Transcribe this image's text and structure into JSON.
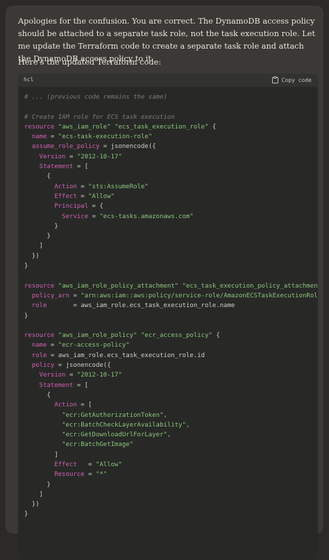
{
  "message": {
    "paragraph1": "Apologies for the confusion. You are correct. The DynamoDB access policy should be attached to a separate task role, not the task execution role. Let me update the Terraform code to create a separate task role and attach the DynamoDB access policy to it.",
    "paragraph2": "Here's the updated Terraform code:"
  },
  "code_block": {
    "language": "hcl",
    "copy_label": "Copy code",
    "copy_icon": "clipboard-icon",
    "lines": [
      [
        {
          "t": "# ... (previous code remains the same)",
          "c": "c"
        }
      ],
      [],
      [
        {
          "t": "# Create IAM role for ECS task execution",
          "c": "c"
        }
      ],
      [
        {
          "t": "resource ",
          "c": "k"
        },
        {
          "t": "\"aws_iam_role\"",
          "c": "s"
        },
        {
          "t": " ",
          "c": "p"
        },
        {
          "t": "\"ecs_task_execution_role\"",
          "c": "s"
        },
        {
          "t": " {",
          "c": "p"
        }
      ],
      [
        {
          "t": "  name",
          "c": "k"
        },
        {
          "t": " = ",
          "c": "p"
        },
        {
          "t": "\"ecs-task-execution-role\"",
          "c": "s"
        }
      ],
      [
        {
          "t": "  assume_role_policy",
          "c": "k"
        },
        {
          "t": " = jsonencode({",
          "c": "p"
        }
      ],
      [
        {
          "t": "    Version",
          "c": "k"
        },
        {
          "t": " = ",
          "c": "p"
        },
        {
          "t": "\"2012-10-17\"",
          "c": "s"
        }
      ],
      [
        {
          "t": "    Statement",
          "c": "k"
        },
        {
          "t": " = [",
          "c": "p"
        }
      ],
      [
        {
          "t": "      {",
          "c": "p"
        }
      ],
      [
        {
          "t": "        Action",
          "c": "k"
        },
        {
          "t": " = ",
          "c": "p"
        },
        {
          "t": "\"sts:AssumeRole\"",
          "c": "s"
        }
      ],
      [
        {
          "t": "        Effect",
          "c": "k"
        },
        {
          "t": " = ",
          "c": "p"
        },
        {
          "t": "\"Allow\"",
          "c": "s"
        }
      ],
      [
        {
          "t": "        Principal",
          "c": "k"
        },
        {
          "t": " = {",
          "c": "p"
        }
      ],
      [
        {
          "t": "          Service",
          "c": "k"
        },
        {
          "t": " = ",
          "c": "p"
        },
        {
          "t": "\"ecs-tasks.amazonaws.com\"",
          "c": "s"
        }
      ],
      [
        {
          "t": "        }",
          "c": "p"
        }
      ],
      [
        {
          "t": "      }",
          "c": "p"
        }
      ],
      [
        {
          "t": "    ]",
          "c": "p"
        }
      ],
      [
        {
          "t": "  })",
          "c": "p"
        }
      ],
      [
        {
          "t": "}",
          "c": "p"
        }
      ],
      [],
      [
        {
          "t": "resource ",
          "c": "k"
        },
        {
          "t": "\"aws_iam_role_policy_attachment\"",
          "c": "s"
        },
        {
          "t": " ",
          "c": "p"
        },
        {
          "t": "\"ecs_task_execution_policy_attachment\"",
          "c": "s"
        },
        {
          "t": " {",
          "c": "p"
        }
      ],
      [
        {
          "t": "  policy_arn",
          "c": "k"
        },
        {
          "t": " = ",
          "c": "p"
        },
        {
          "t": "\"arn:aws:iam::aws:policy/service-role/AmazonECSTaskExecutionRolePoli",
          "c": "s"
        }
      ],
      [
        {
          "t": "  role",
          "c": "k"
        },
        {
          "t": "       = aws_iam_role.ecs_task_execution_role.name",
          "c": "p"
        }
      ],
      [
        {
          "t": "}",
          "c": "p"
        }
      ],
      [],
      [
        {
          "t": "resource ",
          "c": "k"
        },
        {
          "t": "\"aws_iam_role_policy\"",
          "c": "s"
        },
        {
          "t": " ",
          "c": "p"
        },
        {
          "t": "\"ecr_access_policy\"",
          "c": "s"
        },
        {
          "t": " {",
          "c": "p"
        }
      ],
      [
        {
          "t": "  name",
          "c": "k"
        },
        {
          "t": " = ",
          "c": "p"
        },
        {
          "t": "\"ecr-access-policy\"",
          "c": "s"
        }
      ],
      [
        {
          "t": "  role",
          "c": "k"
        },
        {
          "t": " = aws_iam_role.ecs_task_execution_role.id",
          "c": "p"
        }
      ],
      [
        {
          "t": "  policy",
          "c": "k"
        },
        {
          "t": " = jsonencode({",
          "c": "p"
        }
      ],
      [
        {
          "t": "    Version",
          "c": "k"
        },
        {
          "t": " = ",
          "c": "p"
        },
        {
          "t": "\"2012-10-17\"",
          "c": "s"
        }
      ],
      [
        {
          "t": "    Statement",
          "c": "k"
        },
        {
          "t": " = [",
          "c": "p"
        }
      ],
      [
        {
          "t": "      {",
          "c": "p"
        }
      ],
      [
        {
          "t": "        Action",
          "c": "k"
        },
        {
          "t": " = [",
          "c": "p"
        }
      ],
      [
        {
          "t": "          \"ecr:GetAuthorizationToken\",",
          "c": "s"
        }
      ],
      [
        {
          "t": "          \"ecr:BatchCheckLayerAvailability\",",
          "c": "s"
        }
      ],
      [
        {
          "t": "          \"ecr:GetDownloadUrlForLayer\",",
          "c": "s"
        }
      ],
      [
        {
          "t": "          \"ecr:BatchGetImage\"",
          "c": "s"
        }
      ],
      [
        {
          "t": "        ]",
          "c": "p"
        }
      ],
      [
        {
          "t": "        Effect",
          "c": "k"
        },
        {
          "t": "   = ",
          "c": "p"
        },
        {
          "t": "\"Allow\"",
          "c": "s"
        }
      ],
      [
        {
          "t": "        Resource",
          "c": "k"
        },
        {
          "t": " = ",
          "c": "p"
        },
        {
          "t": "\"*\"",
          "c": "s"
        }
      ],
      [
        {
          "t": "      }",
          "c": "p"
        }
      ],
      [
        {
          "t": "    ]",
          "c": "p"
        }
      ],
      [
        {
          "t": "  })",
          "c": "p"
        }
      ],
      [
        {
          "t": "}",
          "c": "p"
        }
      ]
    ]
  }
}
